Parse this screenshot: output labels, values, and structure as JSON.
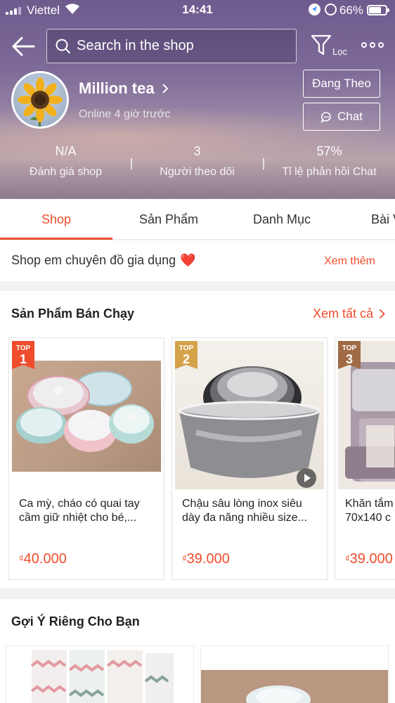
{
  "status_bar": {
    "carrier": "Viettel",
    "time": "14:41",
    "battery": "66%"
  },
  "header": {
    "search_placeholder": "Search in the shop",
    "filter_label": "Lọc",
    "shop_name": "Million tea",
    "online_status": "Online 4 giờ trước",
    "follow_label": "Đang Theo",
    "chat_label": "Chat",
    "stats": [
      {
        "value": "N/A",
        "label": "Đánh giá shop"
      },
      {
        "value": "3",
        "label": "Người theo dõi"
      },
      {
        "value": "57%",
        "label": "Tỉ lệ phản hồi Chat"
      }
    ]
  },
  "tabs": [
    {
      "label": "Shop",
      "active": true
    },
    {
      "label": "Sản Phẩm",
      "active": false
    },
    {
      "label": "Danh Mục",
      "active": false
    },
    {
      "label": "Bài Viết",
      "active": false
    }
  ],
  "description": {
    "text": "Shop em chuyên đồ gia dụng",
    "heart": "❤️",
    "more": "Xem thêm"
  },
  "best_sellers": {
    "title": "Sản Phẩm Bán Chạy",
    "see_all": "Xem tất cả",
    "badge_text": "TOP",
    "items": [
      {
        "rank": "1",
        "name": "Ca mỳ, cháo có quai tay cầm giữ nhiệt cho bé,...",
        "currency": "₫",
        "price": "40.000"
      },
      {
        "rank": "2",
        "name": "Chậu sâu lòng inox siêu dày đa năng nhiều size...",
        "currency": "₫",
        "price": "39.000"
      },
      {
        "rank": "3",
        "name": "Khăn tắm 70x140 c",
        "currency": "₫",
        "price": "39.000"
      }
    ]
  },
  "suggestions": {
    "title": "Gợi Ý Riêng Cho Bạn"
  },
  "colors": {
    "accent": "#ee4d2d",
    "badge_1": "#ee4d2d",
    "badge_2": "#d4a24a",
    "badge_3": "#a06a44"
  }
}
